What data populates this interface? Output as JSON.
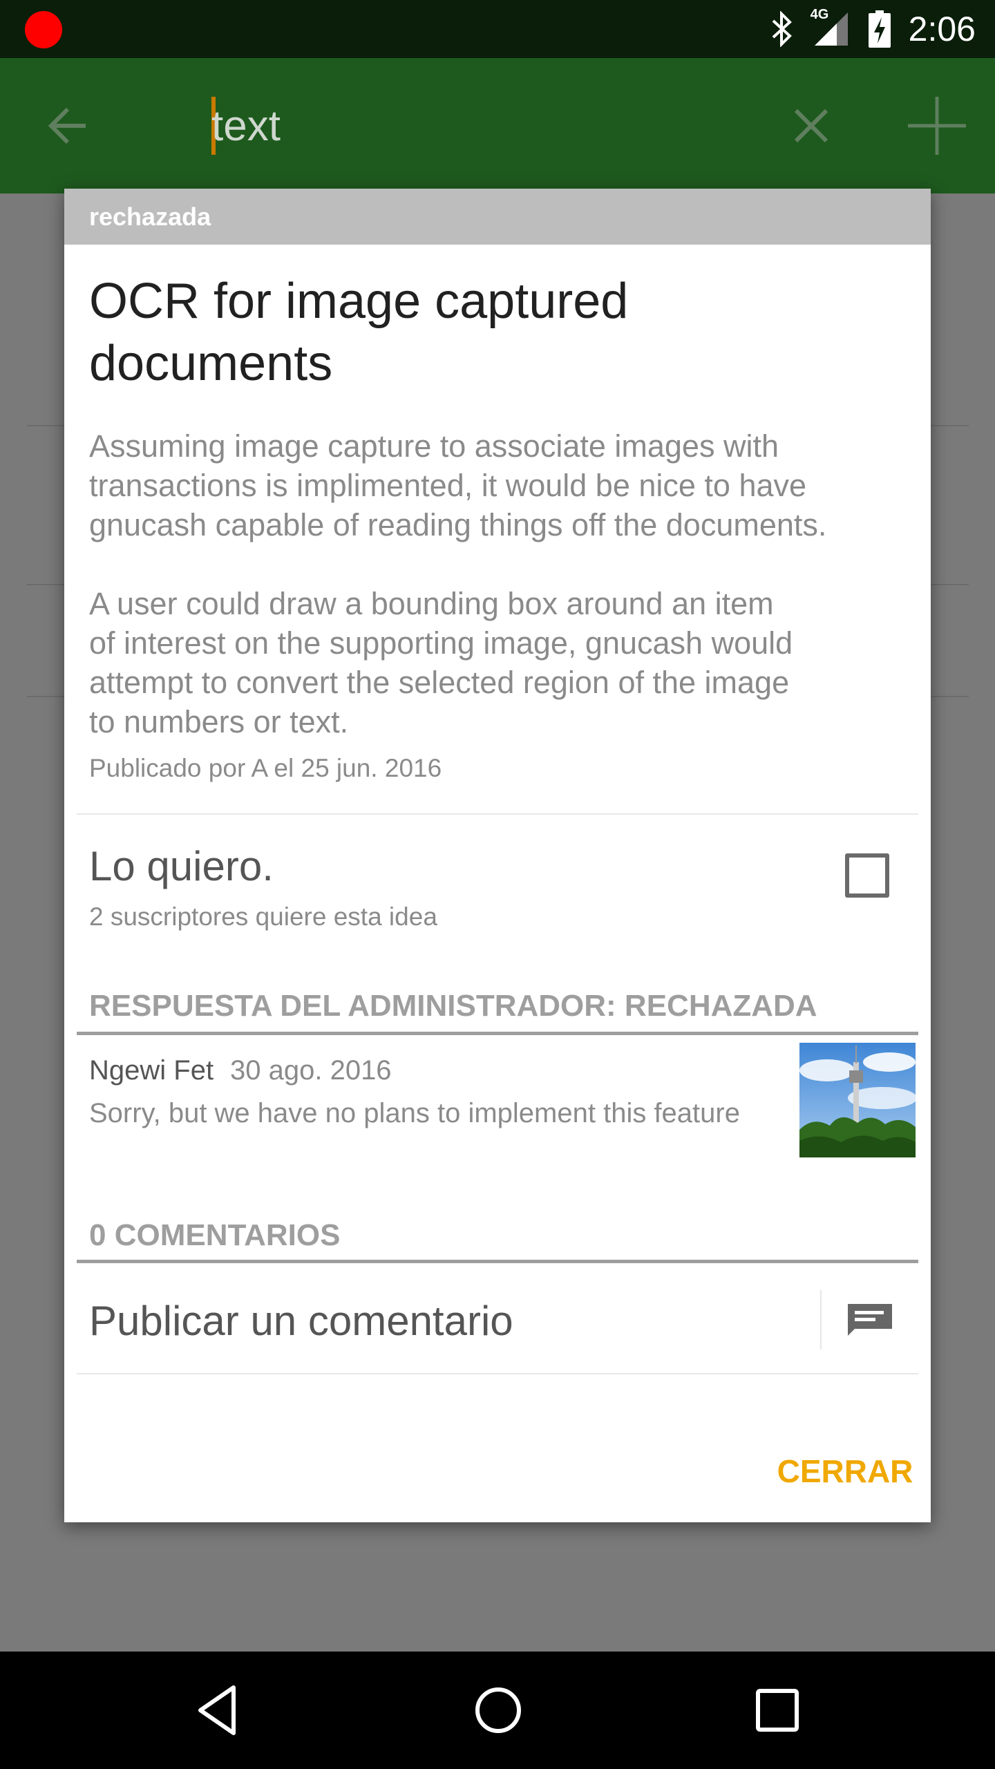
{
  "status_bar": {
    "time": "2:06",
    "network": "4G"
  },
  "app_bar": {
    "search_value": "text",
    "search_placeholder": ""
  },
  "dialog": {
    "status_label": "rechazada",
    "title": "OCR for image captured documents",
    "body": "Assuming image capture to associate images with\ntransactions is implimented, it would be nice to have\ngnucash capable of reading things off the documents.\n\nA user could draw a bounding box around an item\nof interest on the supporting image, gnucash would\nattempt to convert the selected region of the image\nto numbers or text.",
    "meta": "Publicado por A el 25 jun. 2016",
    "want": {
      "label": "Lo quiero.",
      "subscribers": "2 suscriptores quiere esta idea",
      "checked": false
    },
    "admin_response": {
      "heading": "RESPUESTA DEL ADMINISTRADOR: RECHAZADA",
      "author": "Ngewi Fet",
      "date": "30 ago. 2016",
      "text": "Sorry, but we have no plans to implement this feature"
    },
    "comments": {
      "heading": "0 COMENTARIOS",
      "post_placeholder": "Publicar un comentario"
    },
    "close_label": "CERRAR"
  },
  "colors": {
    "app_bar": "#1e5a1e",
    "accent": "#f0a800",
    "status_header": "#bdbdbd"
  }
}
